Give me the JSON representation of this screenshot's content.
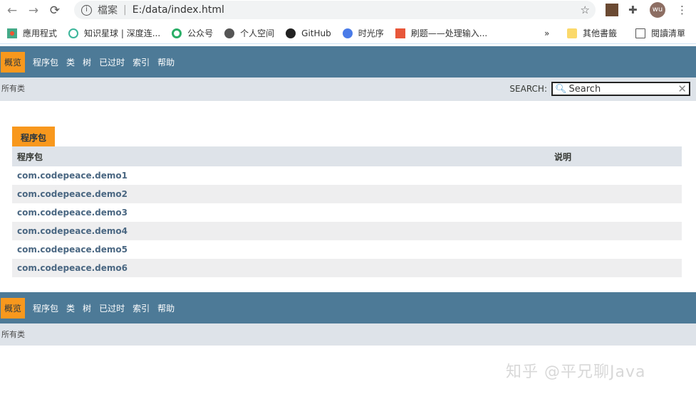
{
  "browser": {
    "security_label": "檔案",
    "url": "E:/data/index.html",
    "profile": "wu",
    "bookmarks": [
      "應用程式",
      "知识星球 | 深度连...",
      "公众号",
      "个人空间",
      "GitHub",
      "时光序",
      "刷题——处理输入..."
    ],
    "overflow": "»",
    "other_bookmarks": "其他書籤",
    "reading_list": "閱讀清單"
  },
  "nav": {
    "items": [
      "概览",
      "程序包",
      "类",
      "树",
      "已过时",
      "索引",
      "帮助"
    ],
    "all_classes": "所有类"
  },
  "search": {
    "label": "SEARCH:",
    "placeholder": "Search"
  },
  "packages": {
    "caption": "程序包",
    "headers": [
      "程序包",
      "说明"
    ],
    "rows": [
      "com.codepeace.demo1",
      "com.codepeace.demo2",
      "com.codepeace.demo3",
      "com.codepeace.demo4",
      "com.codepeace.demo5",
      "com.codepeace.demo6"
    ]
  },
  "watermark": "知乎 @平兄聊Java",
  "colors": {
    "nav": "#4d7a97",
    "active": "#f8981d",
    "subnav": "#dee3e9"
  }
}
